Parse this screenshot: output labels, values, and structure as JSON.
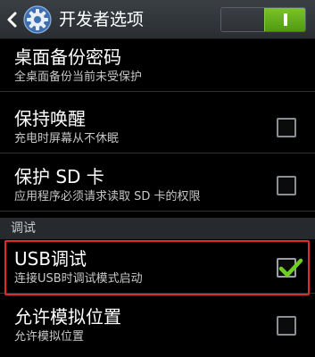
{
  "actionbar": {
    "title": "开发者选项",
    "back_icon": "chevron-left-icon",
    "settings_icon": "gear-icon",
    "master_switch": {
      "state": "on",
      "on_color": "#5aa81a"
    }
  },
  "rows": [
    {
      "title": "桌面备份密码",
      "summary": "全桌面备份当前未受保护"
    },
    {
      "title": "保持唤醒",
      "summary": "充电时屏幕从不休眠",
      "checked": false
    },
    {
      "title": "保护 SD 卡",
      "summary": "应用程序必须请求读取 SD 卡的权限",
      "checked": false
    }
  ],
  "category": {
    "label": "调试"
  },
  "debug_rows": [
    {
      "title": "USB调试",
      "summary": "连接USB时调试模式启动",
      "checked": true,
      "highlight_color": "#e22a2a"
    },
    {
      "title": "允许模拟位置",
      "summary": "允许模拟位置",
      "checked": false
    }
  ]
}
